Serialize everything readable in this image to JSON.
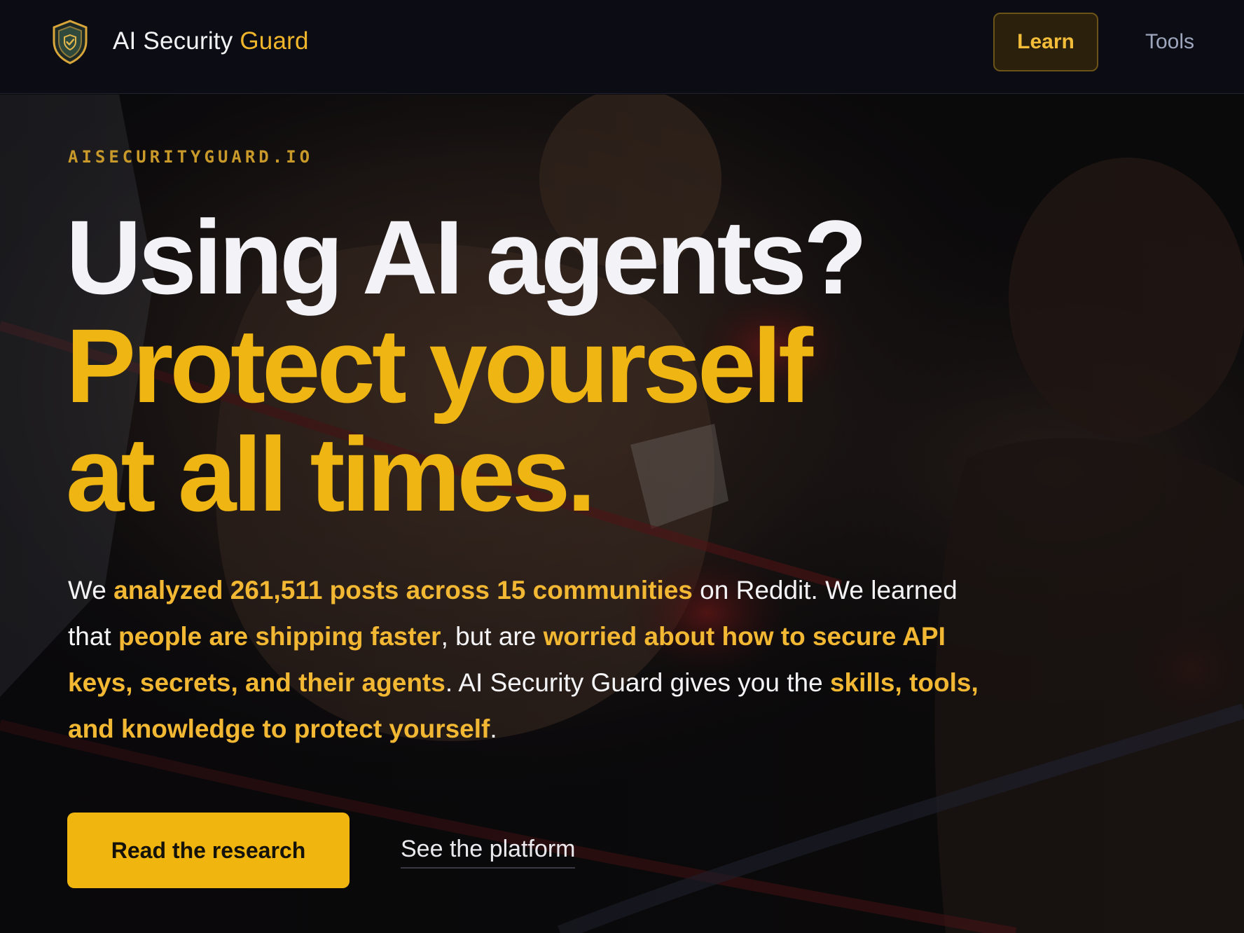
{
  "header": {
    "brand_name": "AI Security",
    "brand_accent": "Guard",
    "logo_icon": "shield-check-icon",
    "nav": [
      {
        "label": "Learn",
        "active": true
      },
      {
        "label": "Tools",
        "active": false
      }
    ]
  },
  "hero": {
    "eyebrow": "AISECURITYGUARD.IO",
    "headline": {
      "line1": "Using AI agents?",
      "line2": "Protect yourself",
      "line3": "at all times."
    },
    "description": [
      {
        "text": "We ",
        "highlight": false
      },
      {
        "text": "analyzed 261,511 posts across 15 communities",
        "highlight": true
      },
      {
        "text": " on Reddit. We learned that ",
        "highlight": false
      },
      {
        "text": "people are shipping faster",
        "highlight": true
      },
      {
        "text": ", but are ",
        "highlight": false
      },
      {
        "text": "worried about how to secure API keys, secrets, and their agents",
        "highlight": true
      },
      {
        "text": ". AI Security Guard gives you the ",
        "highlight": false
      },
      {
        "text": "skills, tools, and knowledge to protect yourself",
        "highlight": true
      },
      {
        "text": ".",
        "highlight": false
      }
    ],
    "primary_cta": "Read the research",
    "secondary_cta": "See the platform"
  },
  "colors": {
    "accent": "#f0b50f",
    "background": "#0c0c14",
    "text": "#f2f2f7",
    "nav_muted": "#9ea6be"
  }
}
